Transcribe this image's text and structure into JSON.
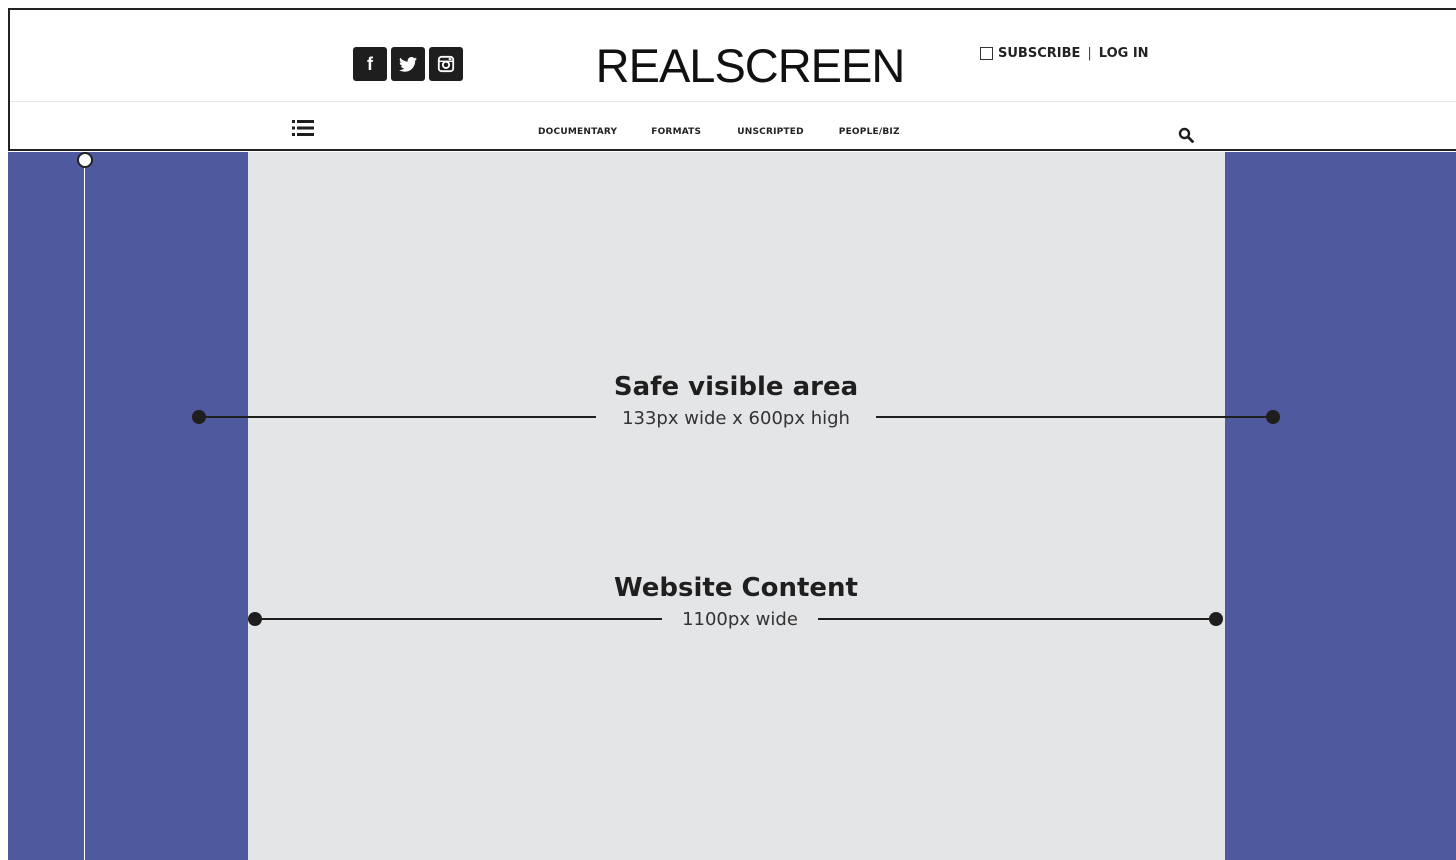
{
  "colors": {
    "side_area": "#4f5a9e",
    "content_area": "#e4e5e7",
    "header_bg": "#ffffff",
    "dark": "#1e1e1e"
  },
  "header": {
    "logo": "REALSCREEN",
    "social": [
      {
        "icon": "facebook-icon",
        "glyph": "f"
      },
      {
        "icon": "twitter-icon"
      },
      {
        "icon": "instagram-icon"
      }
    ],
    "subscribe_label": "SUBSCRIBE",
    "separator": "|",
    "login_label": "LOG IN",
    "menu_icon": "hamburger-list-icon",
    "search_icon": "search-icon",
    "nav": [
      "DOCUMENTARY",
      "FORMATS",
      "UNSCRIPTED",
      "PEOPLE/BIZ"
    ]
  },
  "annotations": {
    "safe_area": {
      "title": "Safe visible area",
      "subtitle": "133px wide x 600px high"
    },
    "website_content": {
      "title": "Website Content",
      "subtitle": "1100px wide"
    }
  }
}
